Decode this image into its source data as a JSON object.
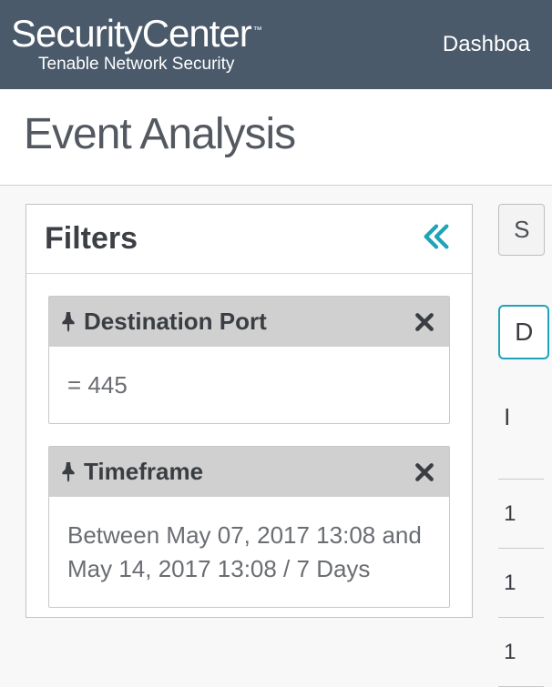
{
  "topbar": {
    "logo_main_left": "Security",
    "logo_main_right": "Center",
    "logo_tm": "™",
    "logo_sub": "Tenable Network Security",
    "nav_dashboard": "Dashboa"
  },
  "page": {
    "title": "Event Analysis"
  },
  "filters": {
    "title": "Filters",
    "items": [
      {
        "name": "Destination Port",
        "value": "= 445"
      },
      {
        "name": "Timeframe",
        "value": "Between May 07, 2017 13:08 and May 14, 2017 13:08 / 7 Days"
      }
    ]
  },
  "rhs": {
    "btn": "S",
    "chip": "D",
    "label": "I",
    "rows": [
      "1",
      "1",
      "1"
    ]
  }
}
